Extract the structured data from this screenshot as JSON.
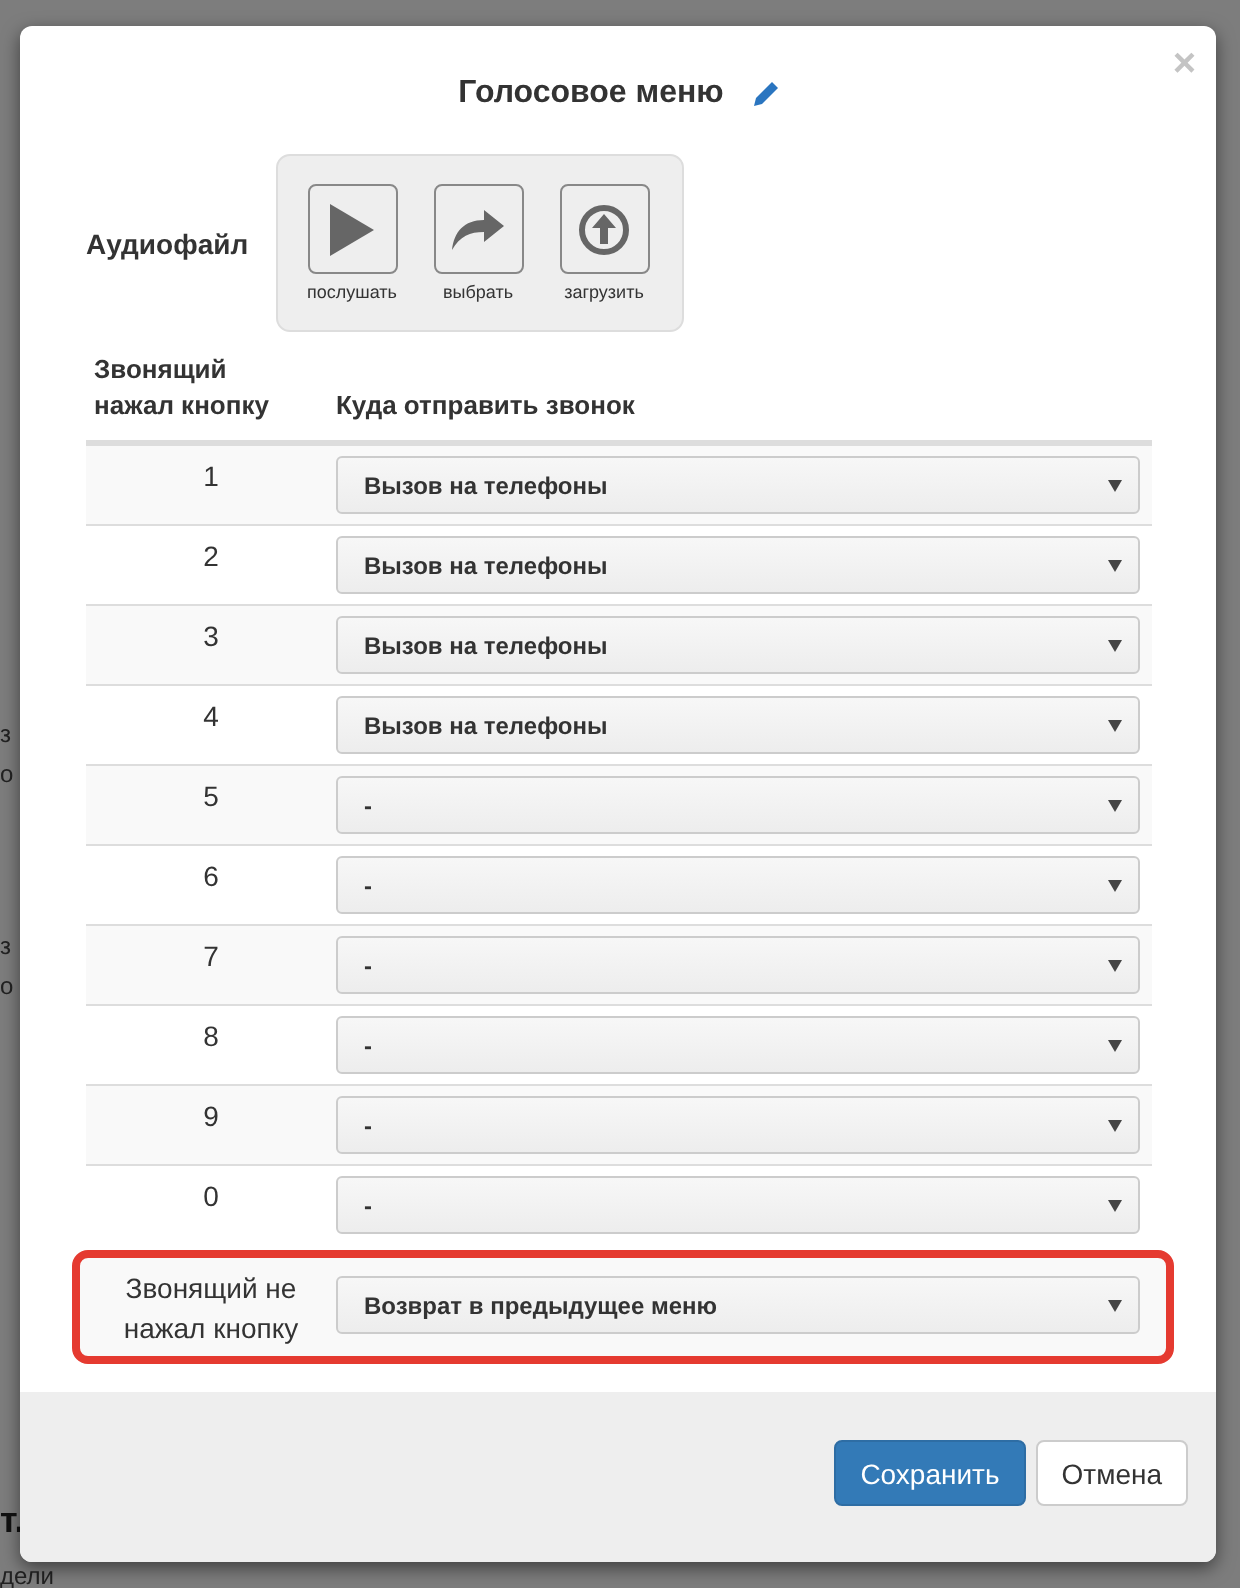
{
  "background": {
    "fragments": [
      "з",
      "о",
      "з",
      "о"
    ],
    "bottom_heading": "т.",
    "bottom_text": "дели"
  },
  "dialog": {
    "title": "Голосовое меню",
    "close": "×",
    "audio": {
      "label": "Аудиофайл",
      "actions": [
        {
          "kind": "play",
          "label": "послушать"
        },
        {
          "kind": "choose",
          "label": "выбрать"
        },
        {
          "kind": "upload",
          "label": "загрузить"
        }
      ]
    },
    "table": {
      "columns": [
        "Звонящий нажал кнопку",
        "Куда отправить звонок"
      ],
      "rows": [
        {
          "key": "1",
          "target": "Вызов на телефоны",
          "highlighted": false
        },
        {
          "key": "2",
          "target": "Вызов на телефоны",
          "highlighted": false
        },
        {
          "key": "3",
          "target": "Вызов на телефоны",
          "highlighted": false
        },
        {
          "key": "4",
          "target": "Вызов на телефоны",
          "highlighted": false
        },
        {
          "key": "5",
          "target": "-",
          "highlighted": false
        },
        {
          "key": "6",
          "target": "-",
          "highlighted": false
        },
        {
          "key": "7",
          "target": "-",
          "highlighted": false
        },
        {
          "key": "8",
          "target": "-",
          "highlighted": false
        },
        {
          "key": "9",
          "target": "-",
          "highlighted": false
        },
        {
          "key": "0",
          "target": "-",
          "highlighted": false
        },
        {
          "key": "Звонящий не нажал кнопку",
          "target": "Возврат в предыдущее меню",
          "highlighted": true
        }
      ]
    },
    "buttons": [
      {
        "kind": "primary",
        "label": "Сохранить"
      },
      {
        "kind": "default",
        "label": "Отмена"
      }
    ]
  }
}
